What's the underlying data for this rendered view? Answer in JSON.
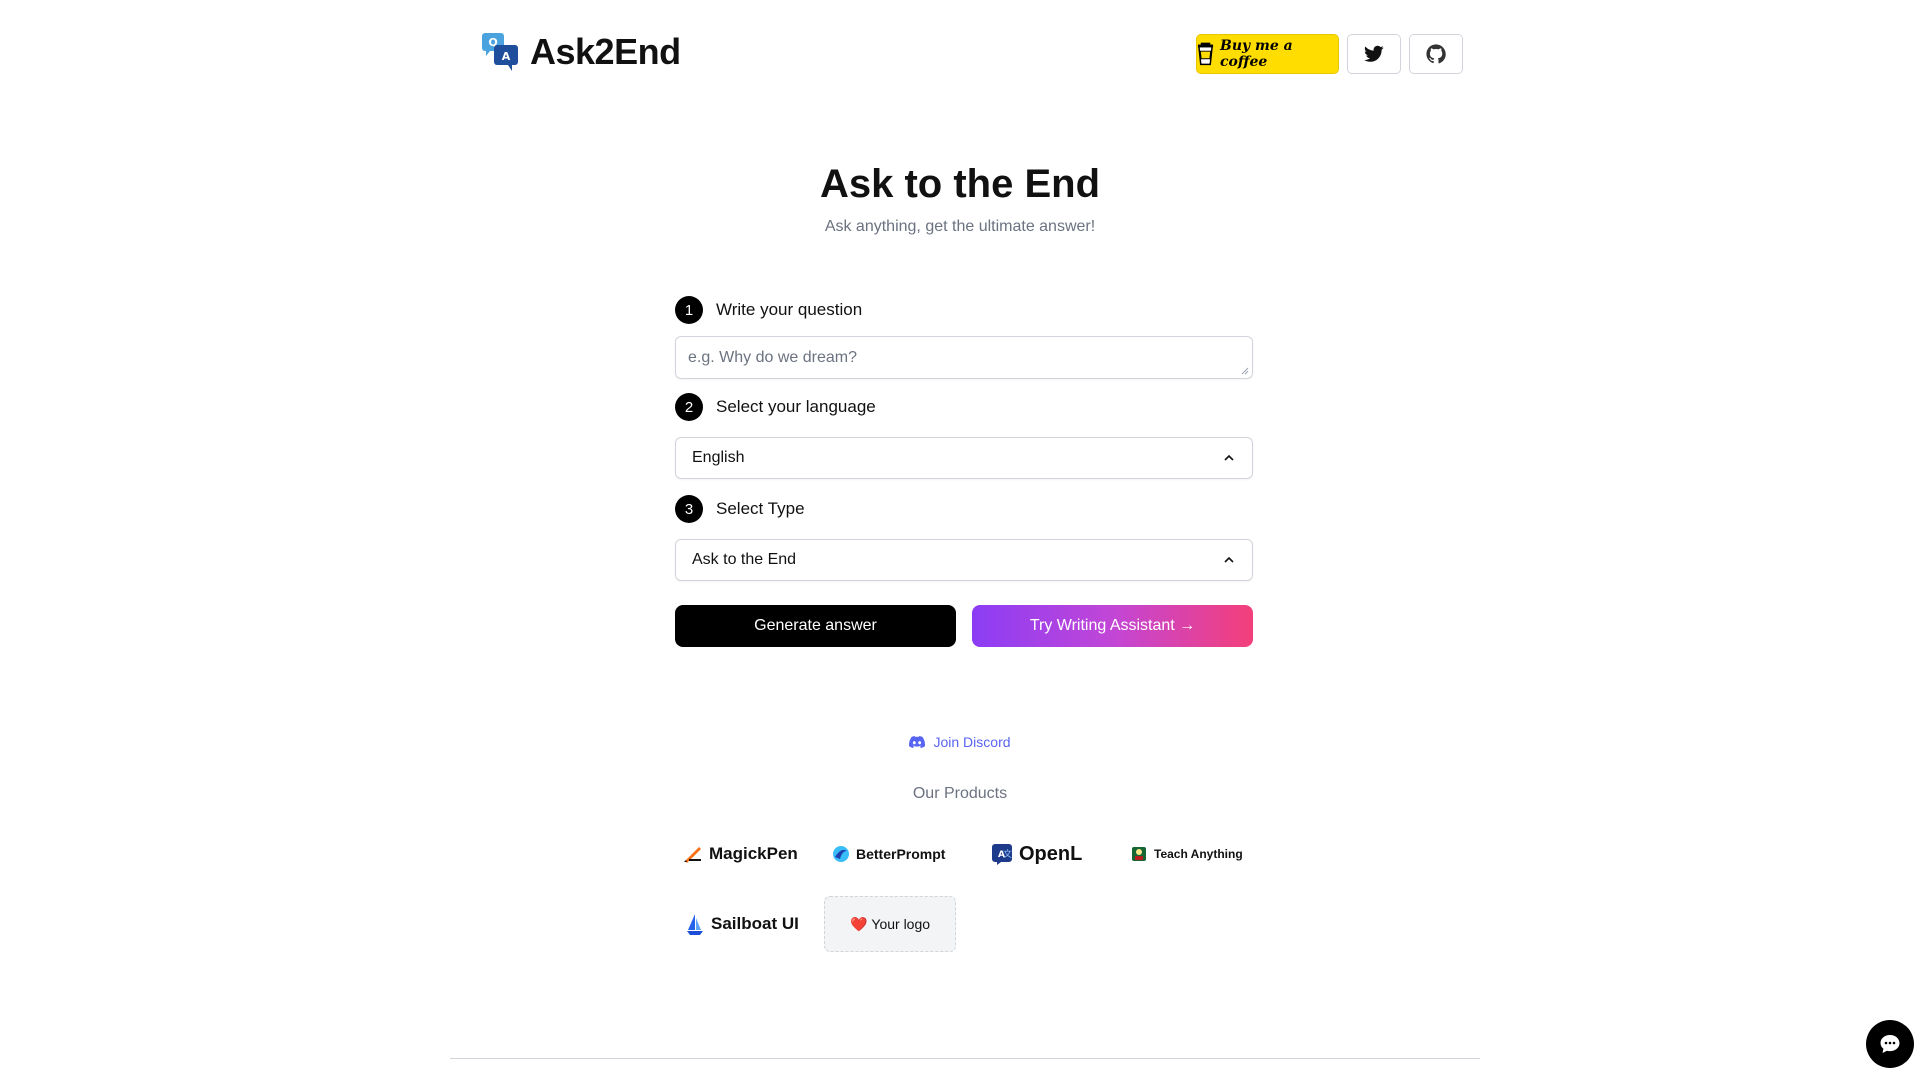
{
  "header": {
    "app_name": "Ask2End",
    "coffee_label": "Buy me a coffee",
    "twitter_icon": "twitter-icon",
    "github_icon": "github-icon"
  },
  "hero": {
    "title": "Ask to the End",
    "subtitle": "Ask anything, get the ultimate answer!"
  },
  "form": {
    "steps": [
      {
        "num": "1",
        "label": "Write your question"
      },
      {
        "num": "2",
        "label": "Select your language"
      },
      {
        "num": "3",
        "label": "Select Type"
      }
    ],
    "question_placeholder": "e.g. Why do we dream?",
    "language_value": "English",
    "type_value": "Ask to the End",
    "generate_label": "Generate answer",
    "writing_label": "Try Writing Assistant →"
  },
  "footer": {
    "discord_label": "Join Discord",
    "products_label": "Our Products",
    "products": [
      {
        "name": "MagickPen"
      },
      {
        "name": "BetterPrompt"
      },
      {
        "name": "OpenL"
      },
      {
        "name": "Teach Anything"
      },
      {
        "name": "Sailboat UI"
      }
    ],
    "your_logo_label": "Your logo",
    "your_logo_emoji": "❤️"
  },
  "colors": {
    "accent": "#000000",
    "coffee": "#FFDD00",
    "gradient_start": "#8b3df5",
    "gradient_end": "#f43f7a",
    "discord": "#5865F2"
  }
}
